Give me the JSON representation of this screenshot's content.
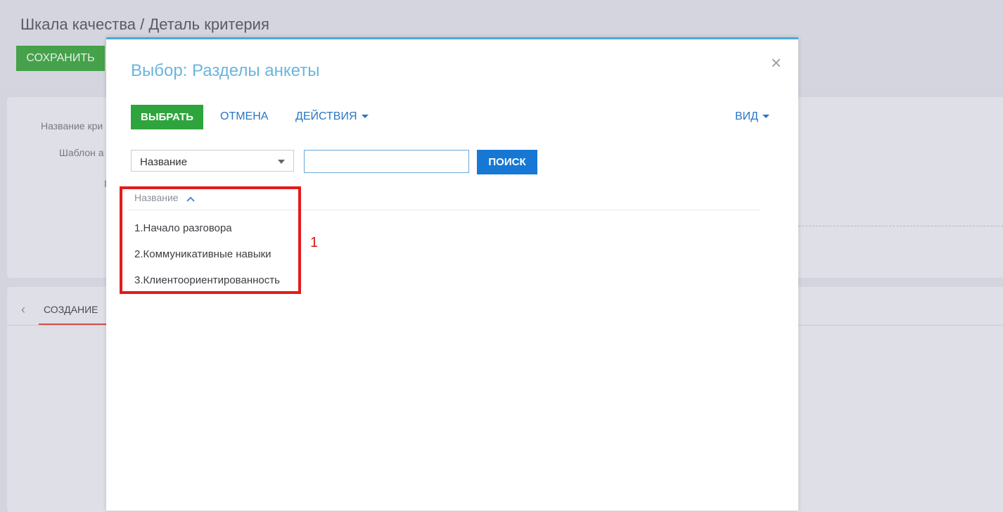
{
  "background": {
    "page_title": "Шкала качества / Деталь критерия",
    "save_label": "СОХРАНИТЬ",
    "fields": {
      "name_label": "Название кри",
      "template_label": "Шаблон а",
      "third_label": "I"
    },
    "tab_label": "СОЗДАНИЕ"
  },
  "modal": {
    "title": "Выбор: Разделы анкеты",
    "close_symbol": "×",
    "toolbar": {
      "select_label": "ВЫБРАТЬ",
      "cancel_label": "ОТМЕНА",
      "actions_label": "ДЕЙСТВИЯ",
      "view_label": "ВИД"
    },
    "filter": {
      "column_selected": "Название",
      "search_value": "",
      "search_button": "ПОИСК"
    },
    "grid": {
      "column_header": "Название",
      "sort_icon": "chevron-up-icon",
      "rows": [
        "1.Начало разговора",
        "2.Коммуникативные навыки",
        "3.Клиентоориентированность"
      ]
    }
  },
  "annotation": {
    "number": "1",
    "color": "#e31b1b"
  }
}
